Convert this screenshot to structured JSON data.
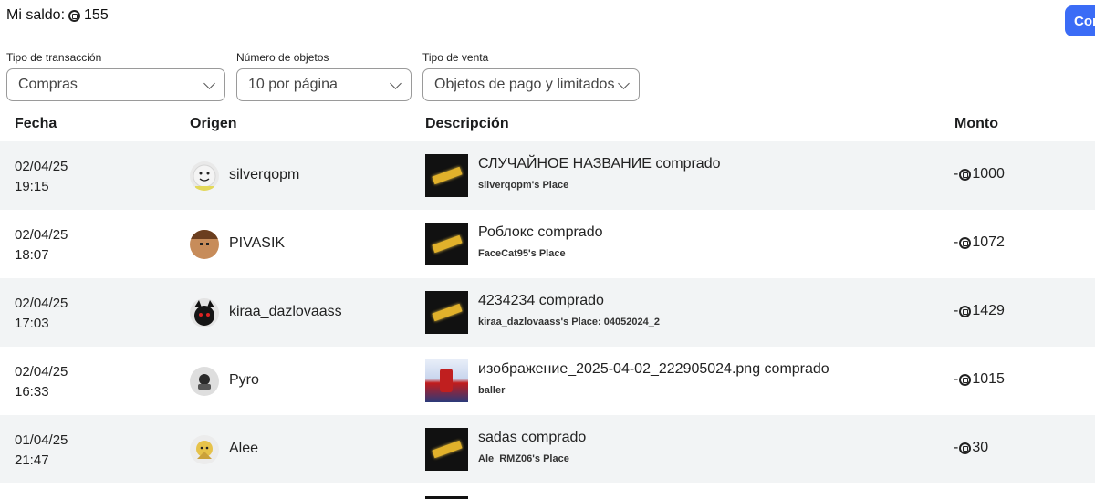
{
  "balance": {
    "label": "Mi saldo:",
    "amount": "155"
  },
  "top_button": {
    "label": "Com"
  },
  "filters": {
    "transaction_type": {
      "label": "Tipo de transacción",
      "value": "Compras"
    },
    "items_count": {
      "label": "Número de objetos",
      "value": "10 por página"
    },
    "sale_type": {
      "label": "Tipo de venta",
      "value": "Objetos de pago y limitados"
    }
  },
  "table": {
    "headers": {
      "date": "Fecha",
      "origin": "Origen",
      "description": "Descripción",
      "amount": "Monto"
    },
    "rows": [
      {
        "date": "02/04/25",
        "time": "19:15",
        "user": "silverqopm",
        "avatar": "smiley-avatar",
        "title": "СЛУЧАЙНОЕ НАЗВАНИЕ comprado",
        "place": "silverqopm's Place",
        "sign": "-",
        "amount": "1000",
        "thumb": "gold-bar"
      },
      {
        "date": "02/04/25",
        "time": "18:07",
        "user": "PIVASIK",
        "avatar": "brown-avatar",
        "title": "Роблокс comprado",
        "place": "FaceCat95's Place",
        "sign": "-",
        "amount": "1072",
        "thumb": "gold-bar"
      },
      {
        "date": "02/04/25",
        "time": "17:03",
        "user": "kiraa_dazlovaass",
        "avatar": "dark-avatar",
        "title": "4234234 comprado",
        "place": "kiraa_dazlovaass's Place: 04052024_2",
        "sign": "-",
        "amount": "1429",
        "thumb": "gold-bar"
      },
      {
        "date": "02/04/25",
        "time": "16:33",
        "user": "Pyro",
        "avatar": "grey-avatar",
        "title": "изображение_2025-04-02_222905024.png comprado",
        "place": "baller",
        "sign": "-",
        "amount": "1015",
        "thumb": "photo"
      },
      {
        "date": "01/04/25",
        "time": "21:47",
        "user": "Alee",
        "avatar": "gold-avatar",
        "title": "sadas comprado",
        "place": "Ale_RMZ06's Place",
        "sign": "-",
        "amount": "30",
        "thumb": "gold-bar"
      }
    ]
  },
  "colors": {
    "accent": "#3b6cf6",
    "row_shade": "#f2f4f5",
    "gold": "#e1b12b"
  }
}
